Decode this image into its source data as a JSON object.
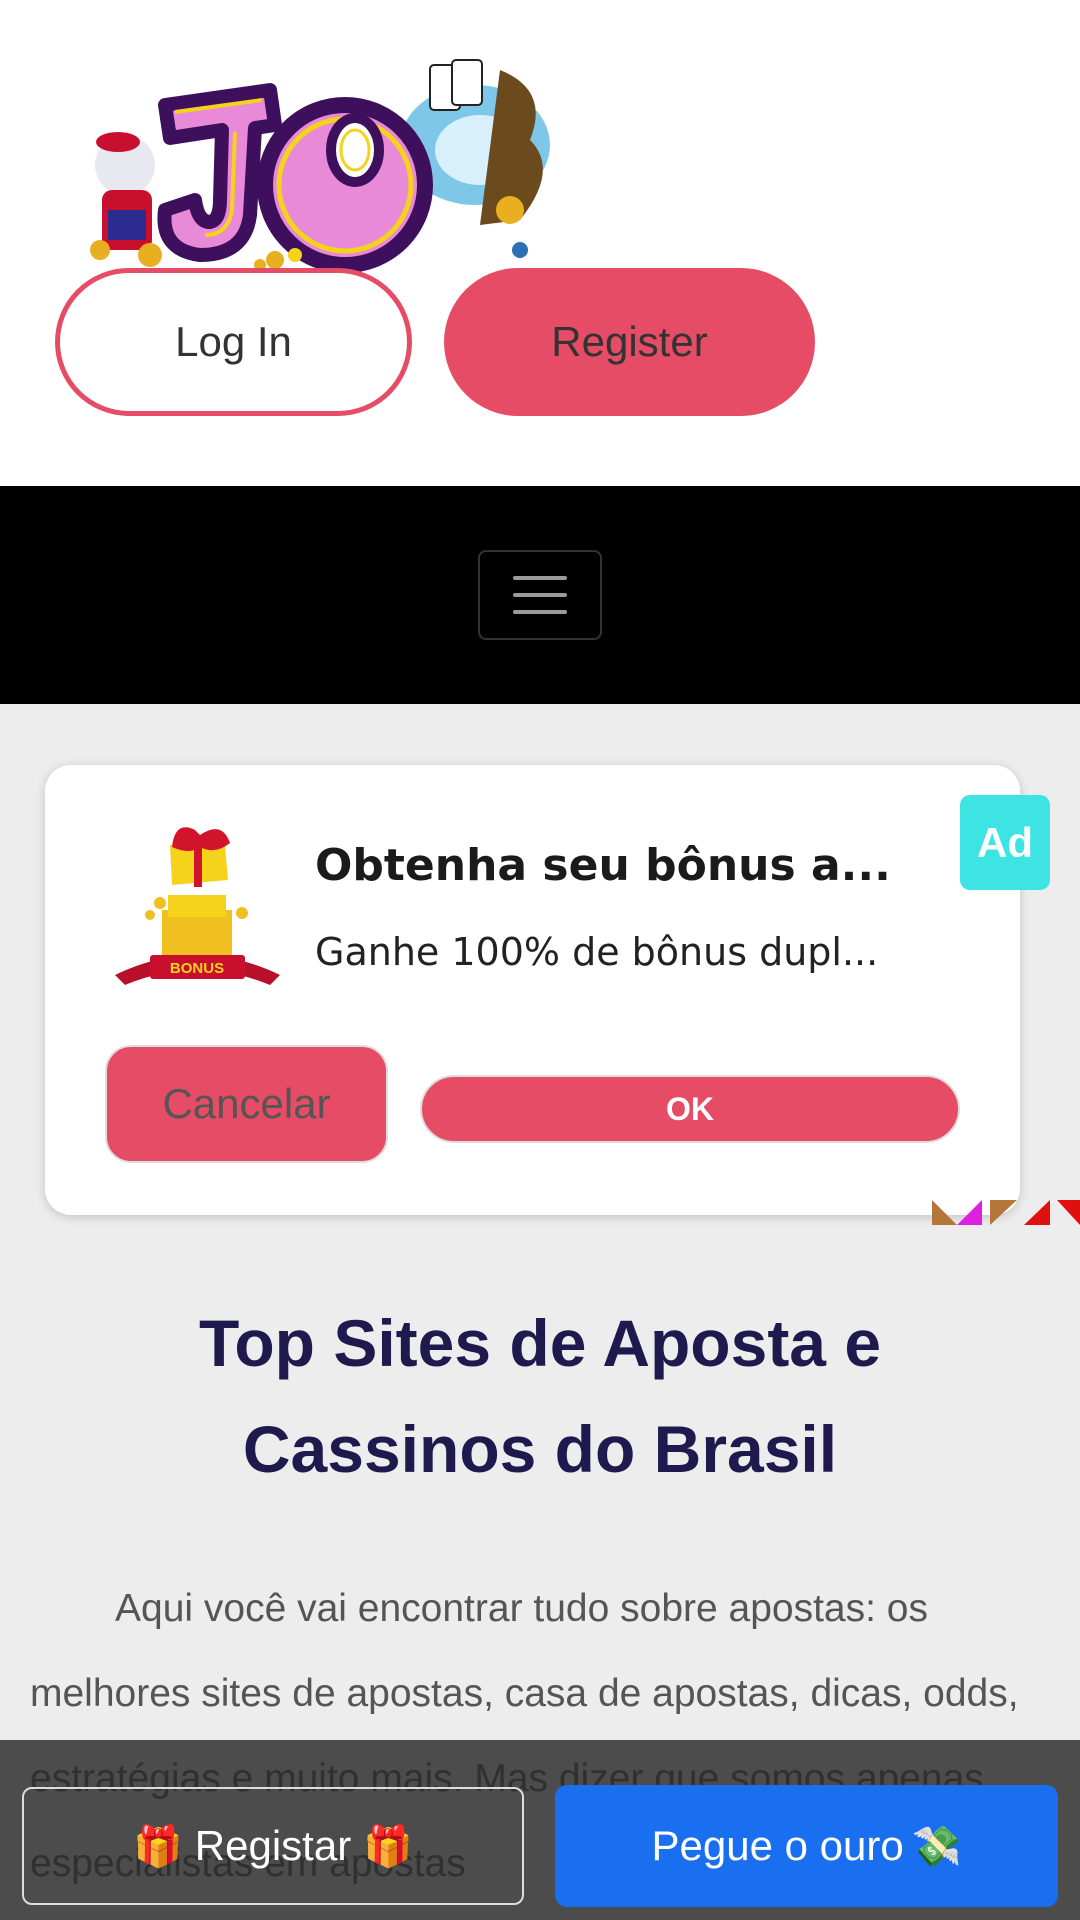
{
  "header": {
    "logo_text": "JO",
    "login_label": "Log In",
    "register_label": "Register",
    "colors": {
      "accent": "#e64c65",
      "logo_purple": "#3d0f5c",
      "logo_gold": "#f5d31a"
    }
  },
  "nav": {
    "menu_icon": "hamburger-menu-icon"
  },
  "ad": {
    "title": "Obtenha seu bônus a...",
    "description": "Ganhe 100% de bônus dupl...",
    "badge": "Ad",
    "icon_text": "BONUS",
    "cancel_label": "Cancelar",
    "ok_label": "OK",
    "colors": {
      "badge": "#3ee4e4",
      "button": "#e64c65"
    }
  },
  "main": {
    "title": "Top Sites de Aposta e Cassinos do Brasil",
    "intro": "Aqui você vai encontrar tudo sobre apostas: os melhores sites de apostas, casa de apostas, dicas, odds, estratégias e muito mais. Mas dizer que somos apenas especialistas em apostas"
  },
  "bottom_bar": {
    "register_label": "Registar",
    "register_icon": "🎁",
    "gold_label": "Pegue o ouro",
    "gold_icon": "💸",
    "colors": {
      "gold_button": "#1a6ff0"
    }
  }
}
